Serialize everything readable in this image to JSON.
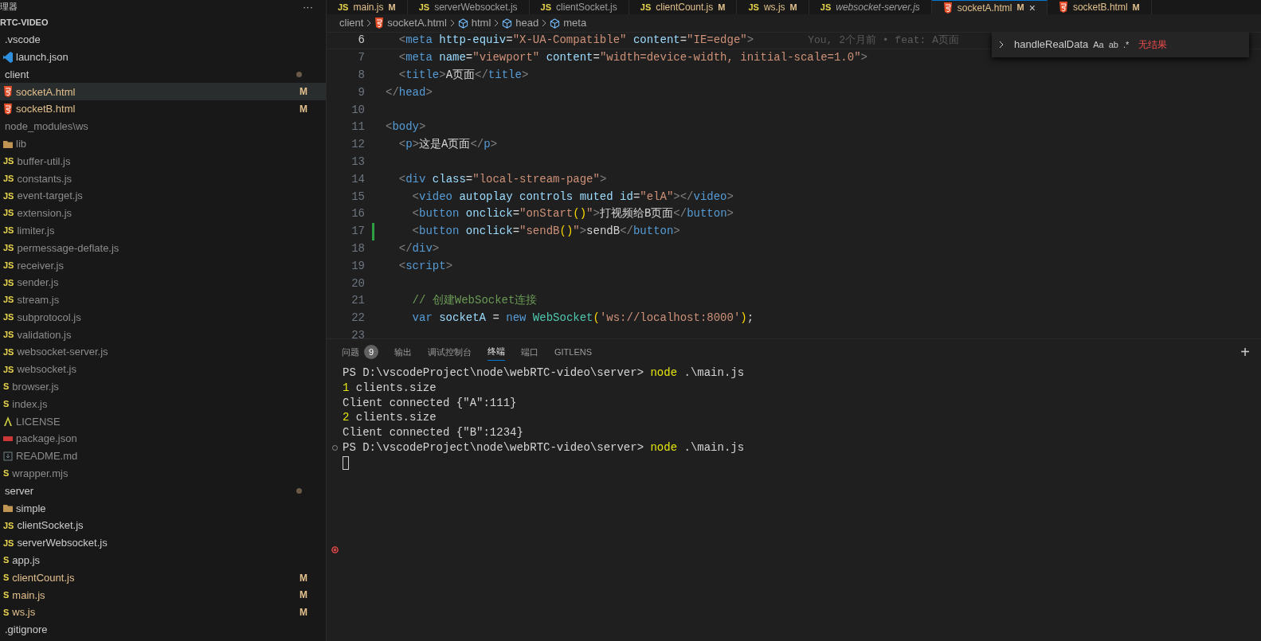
{
  "sidebar": {
    "title": "理器",
    "more": "···",
    "root": "RTC-VIDEO",
    "tree": [
      {
        "name": ".vscode",
        "children": [
          {
            "name": "launch.json",
            "kind": "vscode"
          }
        ]
      },
      {
        "name": "client",
        "dot": true,
        "children": [
          {
            "name": "socketA.html",
            "kind": "html",
            "badge": "M",
            "selected": true
          },
          {
            "name": "socketB.html",
            "kind": "html",
            "badge": "M",
            "selected": false
          }
        ]
      },
      {
        "name": "node_modules\\ws",
        "dim": true,
        "children": [
          {
            "name": "lib",
            "kind": "folder",
            "dim": true,
            "children": [
              {
                "name": "buffer-util.js",
                "kind": "js",
                "glyph": "JS",
                "dim": true
              },
              {
                "name": "constants.js",
                "kind": "js",
                "glyph": "JS",
                "dim": true
              },
              {
                "name": "event-target.js",
                "kind": "js",
                "glyph": "JS",
                "dim": true
              },
              {
                "name": "extension.js",
                "kind": "js",
                "glyph": "JS",
                "dim": true
              },
              {
                "name": "limiter.js",
                "kind": "js",
                "glyph": "JS",
                "dim": true
              },
              {
                "name": "permessage-deflate.js",
                "kind": "js",
                "glyph": "JS",
                "dim": true
              },
              {
                "name": "receiver.js",
                "kind": "js",
                "glyph": "JS",
                "dim": true
              },
              {
                "name": "sender.js",
                "kind": "js",
                "glyph": "JS",
                "dim": true
              },
              {
                "name": "stream.js",
                "kind": "js",
                "glyph": "JS",
                "dim": true
              },
              {
                "name": "subprotocol.js",
                "kind": "js",
                "glyph": "JS",
                "dim": true
              },
              {
                "name": "validation.js",
                "kind": "js",
                "glyph": "JS",
                "dim": true
              },
              {
                "name": "websocket-server.js",
                "kind": "js",
                "glyph": "JS",
                "dim": true
              },
              {
                "name": "websocket.js",
                "kind": "js",
                "glyph": "JS",
                "dim": true
              }
            ]
          },
          {
            "name": "browser.js",
            "kind": "js",
            "glyph": "S",
            "dim": true
          },
          {
            "name": "index.js",
            "kind": "js",
            "glyph": "S",
            "dim": true
          },
          {
            "name": "LICENSE",
            "kind": "license",
            "dim": true
          },
          {
            "name": "package.json",
            "kind": "package",
            "dim": true
          },
          {
            "name": "README.md",
            "kind": "readme",
            "dim": true
          },
          {
            "name": "wrapper.mjs",
            "kind": "js",
            "glyph": "S",
            "dim": true
          }
        ]
      },
      {
        "name": "server",
        "dot": true,
        "children": [
          {
            "name": "simple",
            "kind": "folder",
            "children": [
              {
                "name": "clientSocket.js",
                "kind": "js",
                "glyph": "JS"
              },
              {
                "name": "serverWebsocket.js",
                "kind": "js",
                "glyph": "JS"
              }
            ]
          },
          {
            "name": "app.js",
            "kind": "js",
            "glyph": "S"
          },
          {
            "name": "clientCount.js",
            "kind": "js",
            "glyph": "S",
            "badge": "M"
          },
          {
            "name": "main.js",
            "kind": "js",
            "glyph": "S",
            "badge": "M"
          },
          {
            "name": "ws.js",
            "kind": "js",
            "glyph": "S",
            "badge": "M"
          }
        ]
      },
      {
        "name": ".gitignore"
      }
    ]
  },
  "tabs": [
    {
      "label": "main.js",
      "kind": "js",
      "glyph": "JS",
      "badge": "M",
      "selected": false,
      "preview": false
    },
    {
      "label": "serverWebsocket.js",
      "kind": "js",
      "glyph": "JS",
      "selected": false,
      "preview": false
    },
    {
      "label": "clientSocket.js",
      "kind": "js",
      "glyph": "JS",
      "selected": false,
      "preview": false
    },
    {
      "label": "clientCount.js",
      "kind": "js",
      "glyph": "JS",
      "badge": "M",
      "selected": false,
      "preview": false
    },
    {
      "label": "ws.js",
      "kind": "js",
      "glyph": "JS",
      "badge": "M",
      "selected": false,
      "preview": false
    },
    {
      "label": "websocket-server.js",
      "kind": "js",
      "glyph": "JS",
      "selected": false,
      "preview": true
    },
    {
      "label": "socketA.html",
      "kind": "html",
      "badge": "M",
      "selected": true,
      "preview": false,
      "close": "×"
    },
    {
      "label": "socketB.html",
      "kind": "html",
      "badge": "M",
      "selected": false,
      "preview": false
    }
  ],
  "breadcrumb": [
    {
      "label": "client"
    },
    {
      "label": "socketA.html",
      "kind": "html"
    },
    {
      "label": "html",
      "kind": "element"
    },
    {
      "label": "head",
      "kind": "element"
    },
    {
      "label": "meta",
      "kind": "element"
    }
  ],
  "find_widget": {
    "query": "handleRealData",
    "options": [
      "Aa",
      "ab",
      ".*"
    ],
    "result": "无结果"
  },
  "code": [
    {
      "number": "6",
      "active": true,
      "blame": "You, 2个月前 • feat: A页面",
      "tokens": [
        {
          "t": "  <",
          "kind": "punct"
        },
        {
          "t": "meta",
          "kind": "tag"
        },
        {
          "t": " http-equiv",
          "kind": "attr"
        },
        {
          "t": "=",
          "kind": "text"
        },
        {
          "t": "\"X-UA-Compatible\"",
          "kind": "string"
        },
        {
          "t": " content",
          "kind": "attr"
        },
        {
          "t": "=",
          "kind": "text"
        },
        {
          "t": "\"IE=edge\"",
          "kind": "string"
        },
        {
          "t": ">",
          "kind": "punct"
        }
      ]
    },
    {
      "number": "7",
      "active": false,
      "tokens": [
        {
          "t": "  <",
          "kind": "punct"
        },
        {
          "t": "meta",
          "kind": "tag"
        },
        {
          "t": " name",
          "kind": "attr"
        },
        {
          "t": "=",
          "kind": "text"
        },
        {
          "t": "\"viewport\"",
          "kind": "string"
        },
        {
          "t": " content",
          "kind": "attr"
        },
        {
          "t": "=",
          "kind": "text"
        },
        {
          "t": "\"width=device-width, initial-scale=1.0\"",
          "kind": "string"
        },
        {
          "t": ">",
          "kind": "punct"
        }
      ]
    },
    {
      "number": "8",
      "active": false,
      "tokens": [
        {
          "t": "  <",
          "kind": "punct"
        },
        {
          "t": "title",
          "kind": "tag"
        },
        {
          "t": ">",
          "kind": "punct"
        },
        {
          "t": "A页面",
          "kind": "text"
        },
        {
          "t": "</",
          "kind": "punct"
        },
        {
          "t": "title",
          "kind": "tag"
        },
        {
          "t": ">",
          "kind": "punct"
        }
      ]
    },
    {
      "number": "9",
      "active": false,
      "tokens": [
        {
          "t": "</",
          "kind": "punct"
        },
        {
          "t": "head",
          "kind": "tag"
        },
        {
          "t": ">",
          "kind": "punct"
        }
      ]
    },
    {
      "number": "10",
      "active": false
    },
    {
      "number": "11",
      "active": false,
      "tokens": [
        {
          "t": "<",
          "kind": "punct"
        },
        {
          "t": "body",
          "kind": "tag"
        },
        {
          "t": ">",
          "kind": "punct"
        }
      ]
    },
    {
      "number": "12",
      "active": false,
      "tokens": [
        {
          "t": "  <",
          "kind": "punct"
        },
        {
          "t": "p",
          "kind": "tag"
        },
        {
          "t": ">",
          "kind": "punct"
        },
        {
          "t": "这是A页面",
          "kind": "text"
        },
        {
          "t": "</",
          "kind": "punct"
        },
        {
          "t": "p",
          "kind": "tag"
        },
        {
          "t": ">",
          "kind": "punct"
        }
      ]
    },
    {
      "number": "13",
      "active": false
    },
    {
      "number": "14",
      "active": false,
      "tokens": [
        {
          "t": "  <",
          "kind": "punct"
        },
        {
          "t": "div",
          "kind": "tag"
        },
        {
          "t": " class",
          "kind": "attr"
        },
        {
          "t": "=",
          "kind": "text"
        },
        {
          "t": "\"local-stream-page\"",
          "kind": "string"
        },
        {
          "t": ">",
          "kind": "punct"
        }
      ]
    },
    {
      "number": "15",
      "active": false,
      "tokens": [
        {
          "t": "    <",
          "kind": "punct"
        },
        {
          "t": "video",
          "kind": "tag"
        },
        {
          "t": " autoplay controls muted id",
          "kind": "attr"
        },
        {
          "t": "=",
          "kind": "text"
        },
        {
          "t": "\"elA\"",
          "kind": "string"
        },
        {
          "t": "></",
          "kind": "punct"
        },
        {
          "t": "video",
          "kind": "tag"
        },
        {
          "t": ">",
          "kind": "punct"
        }
      ]
    },
    {
      "number": "16",
      "active": false,
      "tokens": [
        {
          "t": "    <",
          "kind": "punct"
        },
        {
          "t": "button",
          "kind": "tag"
        },
        {
          "t": " onclick",
          "kind": "attr"
        },
        {
          "t": "=",
          "kind": "text"
        },
        {
          "t": "\"onStart",
          "kind": "string"
        },
        {
          "t": "()",
          "kind": "paren"
        },
        {
          "t": "\"",
          "kind": "string"
        },
        {
          "t": ">",
          "kind": "punct"
        },
        {
          "t": "打视频给B页面",
          "kind": "text"
        },
        {
          "t": "</",
          "kind": "punct"
        },
        {
          "t": "button",
          "kind": "tag"
        },
        {
          "t": ">",
          "kind": "punct"
        }
      ]
    },
    {
      "number": "17",
      "active": false,
      "added": true,
      "tokens": [
        {
          "t": "    <",
          "kind": "punct"
        },
        {
          "t": "button",
          "kind": "tag"
        },
        {
          "t": " onclick",
          "kind": "attr"
        },
        {
          "t": "=",
          "kind": "text"
        },
        {
          "t": "\"sendB",
          "kind": "string"
        },
        {
          "t": "()",
          "kind": "paren"
        },
        {
          "t": "\"",
          "kind": "string"
        },
        {
          "t": ">",
          "kind": "punct"
        },
        {
          "t": "sendB",
          "kind": "text"
        },
        {
          "t": "</",
          "kind": "punct"
        },
        {
          "t": "button",
          "kind": "tag"
        },
        {
          "t": ">",
          "kind": "punct"
        }
      ]
    },
    {
      "number": "18",
      "active": false,
      "tokens": [
        {
          "t": "  </",
          "kind": "punct"
        },
        {
          "t": "div",
          "kind": "tag"
        },
        {
          "t": ">",
          "kind": "punct"
        }
      ]
    },
    {
      "number": "19",
      "active": false,
      "tokens": [
        {
          "t": "  <",
          "kind": "punct"
        },
        {
          "t": "script",
          "kind": "tag"
        },
        {
          "t": ">",
          "kind": "punct"
        }
      ]
    },
    {
      "number": "20",
      "active": false
    },
    {
      "number": "21",
      "active": false,
      "tokens": [
        {
          "t": "    // 创建WebSocket连接",
          "kind": "comment"
        }
      ]
    },
    {
      "number": "22",
      "active": false,
      "tokens": [
        {
          "t": "    var",
          "kind": "keyword"
        },
        {
          "t": " socketA",
          "kind": "var"
        },
        {
          "t": " = ",
          "kind": "text"
        },
        {
          "t": "new",
          "kind": "keyword"
        },
        {
          "t": " WebSocket",
          "kind": "class"
        },
        {
          "t": "(",
          "kind": "paren"
        },
        {
          "t": "'ws://localhost:8000'",
          "kind": "string"
        },
        {
          "t": ")",
          "kind": "paren"
        },
        {
          "t": ";",
          "kind": "text"
        }
      ]
    },
    {
      "number": "23",
      "active": false
    }
  ],
  "panel": {
    "tabs": [
      {
        "label": "问题",
        "count": "9",
        "selected": false
      },
      {
        "label": "输出",
        "selected": false
      },
      {
        "label": "调试控制台",
        "selected": false
      },
      {
        "label": "终端",
        "selected": true
      },
      {
        "label": "端口",
        "selected": false
      },
      {
        "label": "GITLENS",
        "selected": false
      }
    ],
    "add": "+"
  },
  "terminal": [
    {
      "command_mark": false,
      "tokens": [
        {
          "t": "PS D:\\vscodeProject\\node\\webRTC-video\\server> ",
          "kind": "text"
        },
        {
          "t": "node",
          "kind": "cmd"
        },
        {
          "t": " .\\main.js",
          "kind": "text"
        }
      ]
    },
    {
      "command_mark": false,
      "tokens": [
        {
          "t": "1",
          "kind": "num"
        },
        {
          "t": " clients.size",
          "kind": "text"
        }
      ]
    },
    {
      "command_mark": false,
      "tokens": [
        {
          "t": "Client connected {\"A\":111}",
          "kind": "text"
        }
      ]
    },
    {
      "command_mark": false,
      "tokens": [
        {
          "t": "2",
          "kind": "num"
        },
        {
          "t": " clients.size",
          "kind": "text"
        }
      ]
    },
    {
      "command_mark": false,
      "tokens": [
        {
          "t": "Client connected {\"B\":1234}",
          "kind": "text"
        }
      ]
    },
    {
      "command_mark": true,
      "tokens": [
        {
          "t": "PS D:\\vscodeProject\\node\\webRTC-video\\server> ",
          "kind": "text"
        },
        {
          "t": "node",
          "kind": "cmd"
        },
        {
          "t": " .\\main.js",
          "kind": "text"
        }
      ]
    },
    {
      "command_mark": false,
      "cursor": true
    }
  ],
  "terminal_error_mark": true
}
